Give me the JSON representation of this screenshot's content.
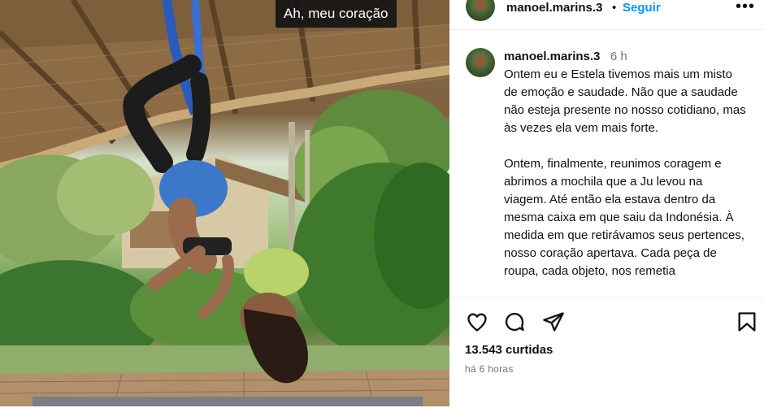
{
  "photo": {
    "caption_sticker": "Ah, meu coração"
  },
  "header": {
    "username": "manoel.marins.3",
    "separator": "•",
    "follow_label": "Seguir",
    "more_label": "•••"
  },
  "post_caption": {
    "username": "manoel.marins.3",
    "time": "6 h",
    "paragraphs": [
      "Ontem eu e Estela tivemos mais um misto de emoção e saudade. Não que a saudade não esteja presente no nosso cotidiano, mas às vezes ela vem mais forte.",
      "Ontem, finalmente, reunimos coragem e abrimos a mochila que a Ju levou na viagem. Até então ela estava dentro da mesma caixa em que saiu da Indonésia. À medida em que retirávamos seus pertences, nosso coração apertava. Cada peça de roupa, cada objeto, nos remetia"
    ]
  },
  "actions": {
    "like_icon": "heart-icon",
    "comment_icon": "comment-icon",
    "share_icon": "send-icon",
    "save_icon": "bookmark-icon"
  },
  "stats": {
    "likes": "13.543 curtidas",
    "time_ago": "há 6 horas"
  }
}
